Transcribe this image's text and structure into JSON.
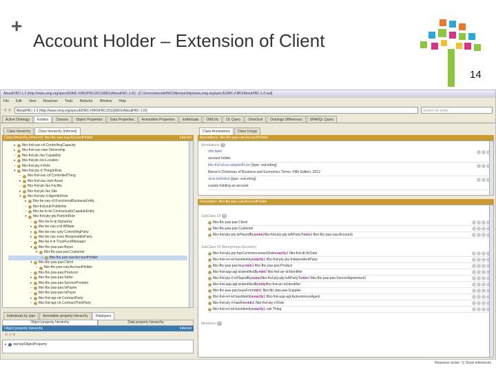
{
  "slide": {
    "title": "Account Holder – Extension of Client",
    "page_number": "14",
    "plus": "+"
  },
  "app": {
    "window_title": "AboutFIBO-1.0 (http://www.omg.org/spec/EDMC-FIBO/FBC/20130801/AboutFBC-1.0/) : [C:\\Users\\ekendall\\WCMtemps\\http/www.omg.org/spec/EDMC-FIBO/AboutFBC-1.0.owl]",
    "menu": [
      "File",
      "Edit",
      "View",
      "Reasoner",
      "Tools",
      "Refactor",
      "Window",
      "Help"
    ],
    "address": "AboutFBC-1.0 (http://www.omg.org/spec/EDMC-FIBO/FBC/20130801/AboutFBC-1.0/)",
    "search_placeholder": "Search for entity",
    "tabs": [
      "Active Ontology",
      "Entities",
      "Classes",
      "Object Properties",
      "Data Properties",
      "Annotation Properties",
      "Individuals",
      "OWLViz",
      "DL Query",
      "OntoGraf",
      "Ontology Differences",
      "SPARQL Query"
    ],
    "left": {
      "subtabs": [
        "Class hierarchy",
        "Class hierarchy (inferred)"
      ],
      "header": "Class hierarchy (inferred): fibo-fbc-pas-caa:AccountHolder",
      "header_right": "Inferred",
      "tree": [
        {
          "d": 1,
          "e": "r",
          "t": "fibo-fnd-oac-ctl:ControllingCapacity"
        },
        {
          "d": 1,
          "e": "r",
          "t": "fibo-fnd-oac-own:Ownership"
        },
        {
          "d": 1,
          "e": "",
          "t": "fibo-fnd-plc-fac:Capability"
        },
        {
          "d": 1,
          "e": "r",
          "t": "fibo-fnd-plc-loc:Location"
        },
        {
          "d": 1,
          "e": "",
          "t": "fibo-fnd-pty-rl:Role"
        },
        {
          "d": 1,
          "e": "d",
          "t": "fibo-fnd-pty-rl:ThingInRole"
        },
        {
          "d": 2,
          "e": "",
          "t": "fibo-fnd-oac-ctl:ControlledThing"
        },
        {
          "d": 2,
          "e": "r",
          "t": "fibo-fnd-oac-own:Asset"
        },
        {
          "d": 2,
          "e": "",
          "t": "fibo-fnd-plc-fac:Facility"
        },
        {
          "d": 2,
          "e": "r",
          "t": "fibo-fnd-plc-fac:Site"
        },
        {
          "d": 2,
          "e": "d",
          "t": "fibo-fnd-pty-rl:AgentInRole"
        },
        {
          "d": 3,
          "e": "r",
          "t": "fibo-be-oac-ctl:FunctionalBusinessEntity"
        },
        {
          "d": 3,
          "e": "",
          "t": "fibo-fnd-pub:Publisher"
        },
        {
          "d": 3,
          "e": "",
          "t": "fibo-be-le-lei:ContractuallyCapableEntity"
        },
        {
          "d": 3,
          "e": "d",
          "t": "fibo-fnd-pty-pty:PartyInRole"
        },
        {
          "d": 4,
          "e": "",
          "t": "fibo-be-le-lp:Signatory"
        },
        {
          "d": 4,
          "e": "r",
          "t": "fibo-be-oac-cctl:Affiliate"
        },
        {
          "d": 4,
          "e": "r",
          "t": "fibo-be-oac-cpty:ControllingParty"
        },
        {
          "d": 4,
          "e": "r",
          "t": "fibo-be-oac-exec:ResponsibleParty"
        },
        {
          "d": 4,
          "e": "",
          "t": "fibo-be-tr-tr:TrustFundManager"
        },
        {
          "d": 4,
          "e": "d",
          "t": "fibo-fbc-pas-pas:Buyer"
        },
        {
          "d": 5,
          "e": "d",
          "t": "fibo-fbc-pas-pas:Customer"
        },
        {
          "d": 6,
          "e": "",
          "t": "fibo-fbc-pas-caa:AccountHolder",
          "sel": true
        },
        {
          "d": 4,
          "e": "d",
          "t": "fibo-fbc-pas-pas:Client"
        },
        {
          "d": 5,
          "e": "",
          "t": "fibo-fbc-pas-caa:AccountHolder"
        },
        {
          "d": 4,
          "e": "",
          "t": "fibo-fbc-pas-pas:Producer"
        },
        {
          "d": 4,
          "e": "r",
          "t": "fibo-fbc-pas-pas:Seller"
        },
        {
          "d": 4,
          "e": "r",
          "t": "fibo-fbc-pas-pas:ServiceProvider"
        },
        {
          "d": 4,
          "e": "",
          "t": "fibo-fbc-pas-pas:IsPayee"
        },
        {
          "d": 4,
          "e": "",
          "t": "fibo-fbc-pas-pas:IsPayer"
        },
        {
          "d": 4,
          "e": "r",
          "t": "fibo-fnd-agr-ctr:ContractParty"
        },
        {
          "d": 4,
          "e": "",
          "t": "fibo-fnd-agr-ctr:ContractThirdParty"
        }
      ],
      "lower_tabs": [
        "Individuals by type",
        "Annotation property hierarchy",
        "Datatypes"
      ],
      "lower_subtabs": [
        "Object property hierarchy",
        "Data property hierarchy"
      ],
      "lower_header": "Object property hierarchy",
      "lower_header_right": "Inferred",
      "lower_item": "owl:topObjectProperty"
    },
    "right": {
      "subtabs": [
        "Class Annotations",
        "Class Usage"
      ],
      "ann_header": "Annotations: fibo-fbc-pas-caa:AccountHolder",
      "ann_label": "Annotations",
      "annotations": [
        {
          "prop": "rdfs:label",
          "extra": "",
          "value": "account holder"
        },
        {
          "prop": "fibo-fnd-utl-av:adaptedFrom",
          "extra": "[type: xsd:string]",
          "value": "Barron's Dictionary of Business and Economics Terms, Fifth Edition, 2012"
        },
        {
          "prop": "skos:definition",
          "extra": "[type: xsd:string]",
          "value": "a party holding an account"
        }
      ],
      "desc_header": "Description: fibo-fbc-pas-caa:AccountHolder",
      "subclass_label": "SubClass Of",
      "subclass": [
        [
          {
            "t": "fibo-fbc-pas-pas:Client"
          }
        ],
        [
          {
            "t": "fibo-fbc-pas-pas:Customer"
          }
        ],
        [
          {
            "t": "fibo-fnd-pty-pty:isPlayedBy "
          },
          {
            "t": "some",
            "k": 1
          },
          {
            "t": " (fibo-fnd-pty-pty:isAPartyTo "
          },
          {
            "t": "min",
            "k": 1
          },
          {
            "t": " 1 fibo-fbc-pas-caa:Account)"
          }
        ]
      ],
      "anon_label": "SubClass Of (Anonymous Ancestor)",
      "anon": [
        [
          {
            "t": "fibo-fnd-pty-pty:hasCommencementDate "
          },
          {
            "t": "exactly",
            "k": 1
          },
          {
            "t": " 1 fibo-fnd-dt-fd:Date"
          }
        ],
        [
          {
            "t": "fibo-fnd-rel-rel:hasIdentity "
          },
          {
            "t": "exactly",
            "k": 1
          },
          {
            "t": " 1 fibo-fnd-pty-pty:IndependentParty"
          }
        ],
        [
          {
            "t": "fibo-fbc-pas-pas:buys "
          },
          {
            "t": "min",
            "k": 1
          },
          {
            "t": " 1 fibo-fbc-pas-pas:Product"
          }
        ],
        [
          {
            "t": "fibo-fnd-aap-agt:isIdentifiedBy "
          },
          {
            "t": "min",
            "k": 1
          },
          {
            "t": " 0 fibo-fnd-arr-id:Identifier"
          }
        ],
        [
          {
            "t": "fibo-fnd-pty-rl:isPlayedBy "
          },
          {
            "t": "some",
            "k": 1
          },
          {
            "t": " (fibo-fnd-pty-pty:isAPartyTo "
          },
          {
            "t": "min",
            "k": 1
          },
          {
            "t": " 1 fibo-fbc-pas-pas:ServiceAgreement)"
          }
        ],
        [
          {
            "t": "fibo-fnd-aap-agt:isIdentifiedBy "
          },
          {
            "t": "only",
            "k": 1
          },
          {
            "t": " fibo-fnd-arr-id:Identifier"
          }
        ],
        [
          {
            "t": "fibo-fbc-pas-pas:buysFrom "
          },
          {
            "t": "min",
            "k": 1
          },
          {
            "t": " 1 fibo-fbc-pas-pas:Supplier"
          }
        ],
        [
          {
            "t": "fibo-fnd-rel-rel:hasIdentity "
          },
          {
            "t": "exactly",
            "k": 1
          },
          {
            "t": " 1 fibo-fnd-aap-agt:AutonomousAgent"
          }
        ],
        [
          {
            "t": "fibo-fnd-pty-rl:hasRole "
          },
          {
            "t": "min",
            "k": 1
          },
          {
            "t": " 1 fibo-fnd-pty-rl:Role"
          }
        ],
        [
          {
            "t": "fibo-fnd-rel-rel:hasIdentity "
          },
          {
            "t": "exactly",
            "k": 1
          },
          {
            "t": " 1 owl:Thing"
          }
        ]
      ],
      "members_label": "Members",
      "footer_reasoner": "Reasoner active",
      "footer_inferences": "Show Inferences"
    }
  }
}
